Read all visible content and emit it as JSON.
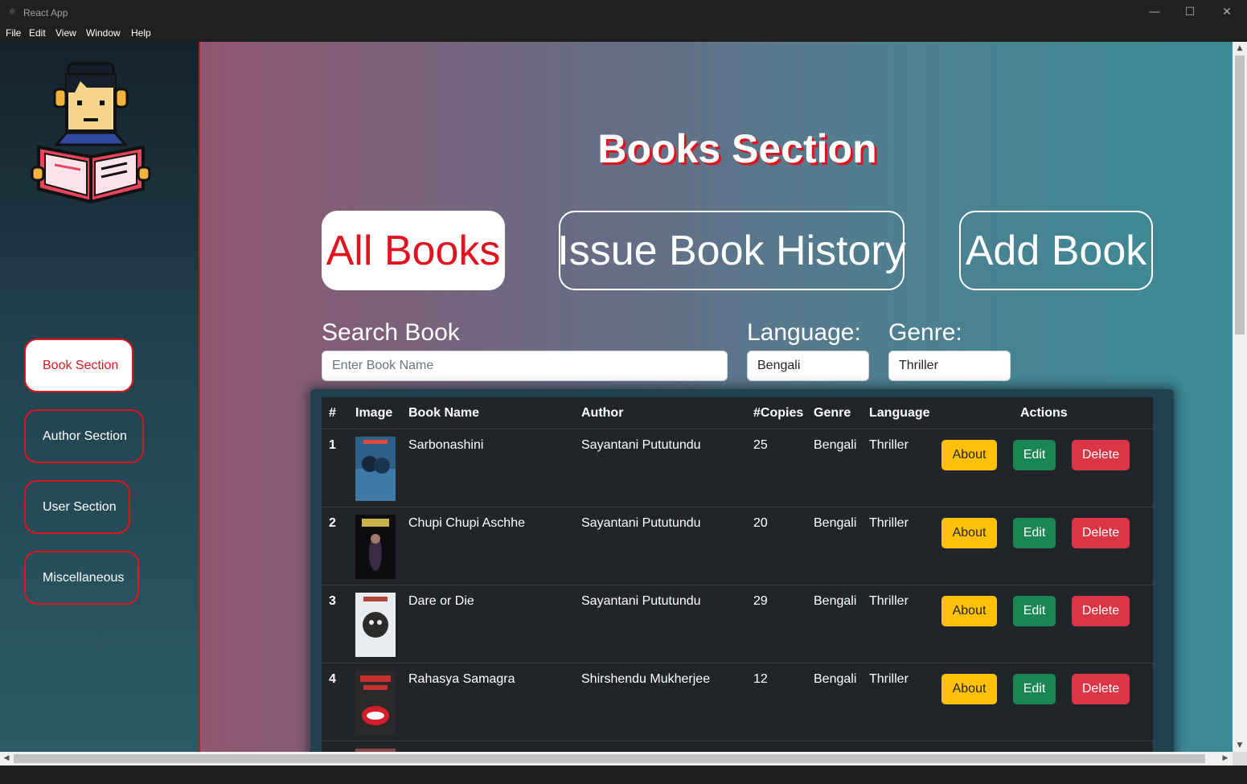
{
  "window": {
    "title": "React App",
    "minimize_icon": "minimize-icon",
    "maximize_icon": "maximize-icon",
    "close_icon": "close-icon"
  },
  "menu": [
    "File",
    "Edit",
    "View",
    "Window",
    "Help"
  ],
  "sidebar": {
    "logo": "reader-mascot-logo",
    "items": [
      {
        "label": "Book Section",
        "active": true
      },
      {
        "label": "Author Section",
        "active": false
      },
      {
        "label": "User Section",
        "active": false
      },
      {
        "label": "Miscellaneous",
        "active": false
      }
    ]
  },
  "main": {
    "title": "Books Section",
    "tabs": [
      {
        "label": "All Books",
        "active": true
      },
      {
        "label": "Issue Book History",
        "active": false
      },
      {
        "label": "Add Book",
        "active": false
      }
    ],
    "search": {
      "label": "Search Book",
      "placeholder": "Enter Book Name",
      "value": ""
    },
    "language": {
      "label": "Language:",
      "value": "Bengali"
    },
    "genre": {
      "label": "Genre:",
      "value": "Thriller"
    }
  },
  "table": {
    "headers": [
      "#",
      "Image",
      "Book Name",
      "Author",
      "#Copies",
      "Genre",
      "Language",
      "Actions"
    ],
    "action_labels": {
      "about": "About",
      "edit": "Edit",
      "delete": "Delete"
    },
    "rows": [
      {
        "num": "1",
        "name": "Sarbonashini",
        "author": "Sayantani Pututundu",
        "copies": "25",
        "genre": "Bengali",
        "language": "Thriller"
      },
      {
        "num": "2",
        "name": "Chupi Chupi Aschhe",
        "author": "Sayantani Pututundu",
        "copies": "20",
        "genre": "Bengali",
        "language": "Thriller"
      },
      {
        "num": "3",
        "name": "Dare or Die",
        "author": "Sayantani Pututundu",
        "copies": "29",
        "genre": "Bengali",
        "language": "Thriller"
      },
      {
        "num": "4",
        "name": "Rahasya Samagra",
        "author": "Shirshendu Mukherjee",
        "copies": "12",
        "genre": "Bengali",
        "language": "Thriller"
      }
    ]
  },
  "colors": {
    "accent_red": "#e0141e",
    "about_button": "#ffc107",
    "edit_button": "#198754",
    "delete_button": "#dc3545",
    "table_bg": "#212529"
  }
}
